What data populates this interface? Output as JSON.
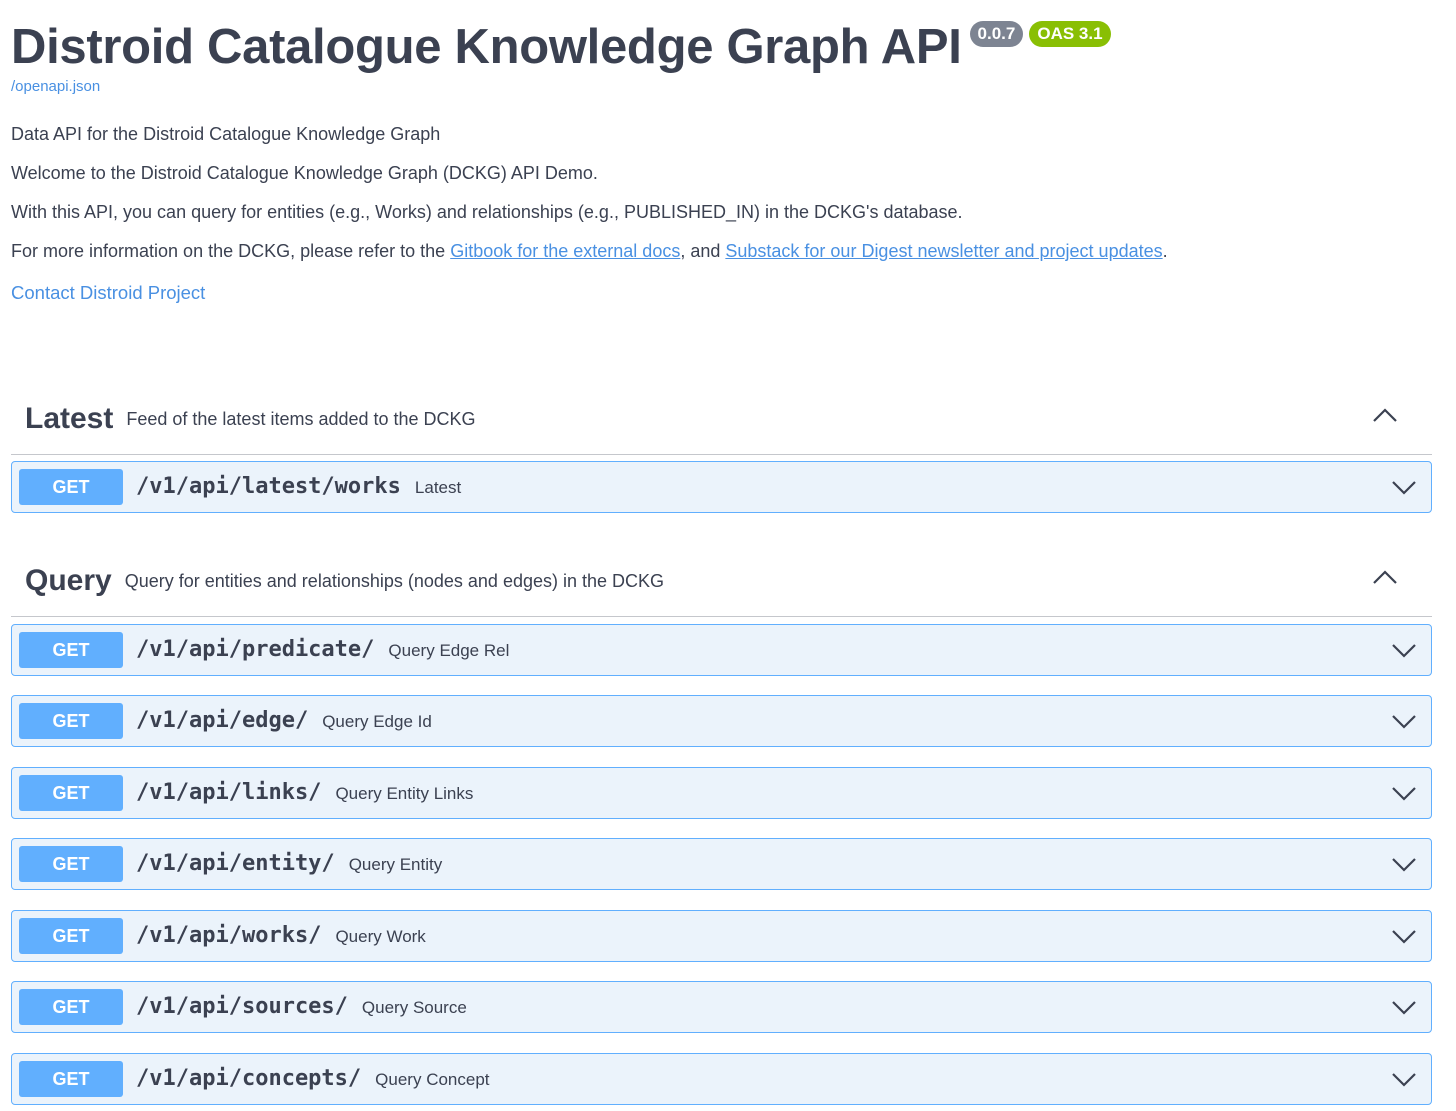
{
  "info": {
    "title": "Distroid Catalogue Knowledge Graph API",
    "version_badge": "0.0.7",
    "oas_badge": "OAS 3.1",
    "spec_link": "/openapi.json",
    "description": {
      "line1": "Data API for the Distroid Catalogue Knowledge Graph",
      "line2": "Welcome to the Distroid Catalogue Knowledge Graph (DCKG) API Demo.",
      "line3": "With this API, you can query for entities (e.g., Works) and relationships (e.g., PUBLISHED_IN) in the DCKG's database.",
      "line4_prefix": "For more information on the DCKG, please refer to the ",
      "line4_link1": "Gitbook for the external docs",
      "line4_mid": ", and ",
      "line4_link2": "Substack for our Digest newsletter and project updates",
      "line4_suffix": "."
    },
    "contact": "Contact Distroid Project"
  },
  "tags": [
    {
      "name": "Latest",
      "description": "Feed of the latest items added to the DCKG",
      "arrow_icon": "chevron-up-icon",
      "operations": [
        {
          "method": "GET",
          "path": "/v1/api/latest/works",
          "summary": "Latest"
        }
      ]
    },
    {
      "name": "Query",
      "description": "Query for entities and relationships (nodes and edges) in the DCKG",
      "arrow_icon": "chevron-up-icon",
      "operations": [
        {
          "method": "GET",
          "path": "/v1/api/predicate/",
          "summary": "Query Edge Rel"
        },
        {
          "method": "GET",
          "path": "/v1/api/edge/",
          "summary": "Query Edge Id"
        },
        {
          "method": "GET",
          "path": "/v1/api/links/",
          "summary": "Query Entity Links"
        },
        {
          "method": "GET",
          "path": "/v1/api/entity/",
          "summary": "Query Entity"
        },
        {
          "method": "GET",
          "path": "/v1/api/works/",
          "summary": "Query Work"
        },
        {
          "method": "GET",
          "path": "/v1/api/sources/",
          "summary": "Query Source"
        },
        {
          "method": "GET",
          "path": "/v1/api/concepts/",
          "summary": "Query Concept"
        }
      ]
    }
  ],
  "colors": {
    "text": "#3b4151",
    "link": "#4990e2",
    "get_accent": "#61affe",
    "get_background": "#ebf3fb",
    "version_badge": "#7d8492",
    "oas_badge": "#89bf04"
  }
}
